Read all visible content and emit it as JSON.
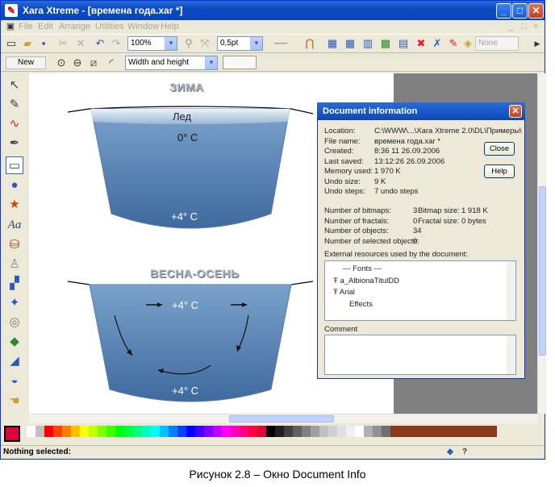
{
  "window": {
    "title": "Xara Xtreme - [времена года.xar *]",
    "controls": {
      "minimize": "_",
      "maximize": "□",
      "close": "✕"
    }
  },
  "menu": {
    "items": [
      "File",
      "Edit",
      "Arrange",
      "Utilities",
      "Window",
      "Help"
    ],
    "mdi_controls": [
      "_",
      "□",
      "×"
    ]
  },
  "toolbar": {
    "zoom": "100%",
    "line_width": "0,5pt",
    "effect": "None"
  },
  "infobar": {
    "new_button": "New",
    "shape_combo": "Width and height"
  },
  "canvas": {
    "winter": {
      "title": "ЗИМА",
      "ice": "Лед",
      "top_temp": "0° С",
      "bottom_temp": "+4° С"
    },
    "spring_autumn": {
      "title": "ВЕСНА-ОСЕНЬ",
      "top_temp": "+4° С",
      "bottom_temp": "+4° С"
    },
    "lake_color": "#4a77ab"
  },
  "dialog": {
    "title": "Document information",
    "close_button": "Close",
    "help_button": "Help",
    "info": [
      {
        "label": "Location:",
        "value": "C:\\WWW\\...\\Xara Xtreme 2.0\\DL\\Примеры\\"
      },
      {
        "label": "File name:",
        "value": "времена года.xar *"
      },
      {
        "label": "Created:",
        "value": "8:36 11 26.09.2006"
      },
      {
        "label": "Last saved:",
        "value": "13:12:26 26.09.2006"
      },
      {
        "label": "Memory used:",
        "value": "1 970 K"
      },
      {
        "label": "Undo size:",
        "value": "9 K"
      },
      {
        "label": "Undo steps:",
        "value": "7 undo steps"
      }
    ],
    "counts_left": [
      {
        "label": "Number of bitmaps:",
        "value": "3"
      },
      {
        "label": "Number of fractals:",
        "value": "0"
      },
      {
        "label": "Number of objects:",
        "value": "34"
      },
      {
        "label": "Number of selected objects:",
        "value": "0"
      }
    ],
    "counts_right": [
      {
        "label": "Bitmap size:",
        "value": "1 918 K"
      },
      {
        "label": "Fractal size:",
        "value": "0 bytes"
      }
    ],
    "resources_label": "External resources used by the document:",
    "resources": [
      {
        "text": "--- Fonts ---",
        "indent": 0
      },
      {
        "text": "a_AlbionaTitulDD",
        "indent": 1
      },
      {
        "text": "Arial",
        "indent": 1
      },
      {
        "text": "Effects",
        "indent": 2
      }
    ],
    "comment_label": "Comment"
  },
  "status": {
    "text": "Nothing selected:"
  },
  "caption": "Рисунок 2.8 – Окно Document Info"
}
